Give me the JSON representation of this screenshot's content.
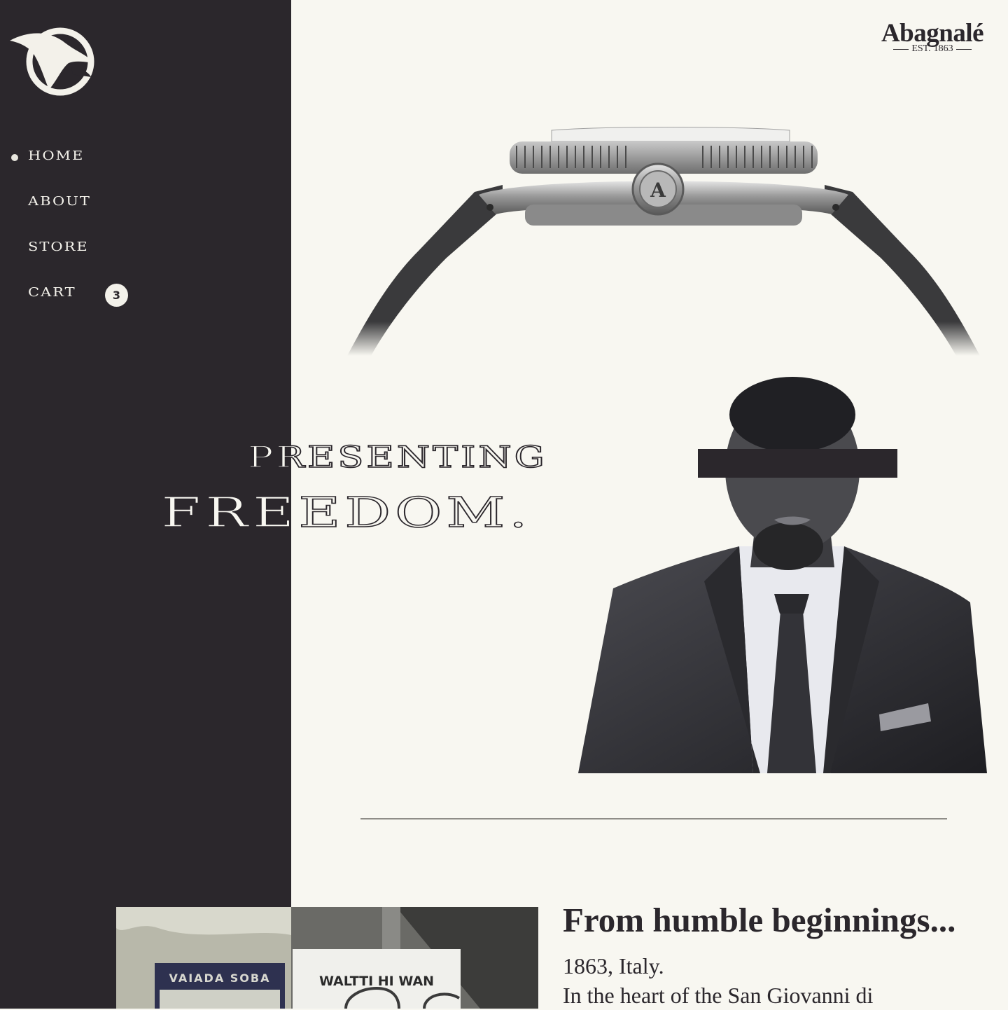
{
  "colors": {
    "sidebar": "#2b272c",
    "page": "#f8f7f1",
    "ink": "#2b272c",
    "light": "#f3f1ea"
  },
  "nav": {
    "items": [
      {
        "label": "HOME",
        "active": true
      },
      {
        "label": "ABOUT"
      },
      {
        "label": "STORE"
      },
      {
        "label": "CART"
      }
    ],
    "cart_count": "3"
  },
  "brand": {
    "name": "Abagnalé",
    "est_label": "EST.",
    "est_year": "1863"
  },
  "watch": {
    "crown_letter": "A"
  },
  "hero": {
    "line1": "PRESENTING",
    "line2": "FREEDOM."
  },
  "story": {
    "title": "From humble beginnings...",
    "line1": "1863, Italy.",
    "line2": "In the heart of the San Giovanni di"
  },
  "photo": {
    "sign_left": "VAIADA SOBA",
    "sign_right": "WALTTI HI WAN"
  }
}
